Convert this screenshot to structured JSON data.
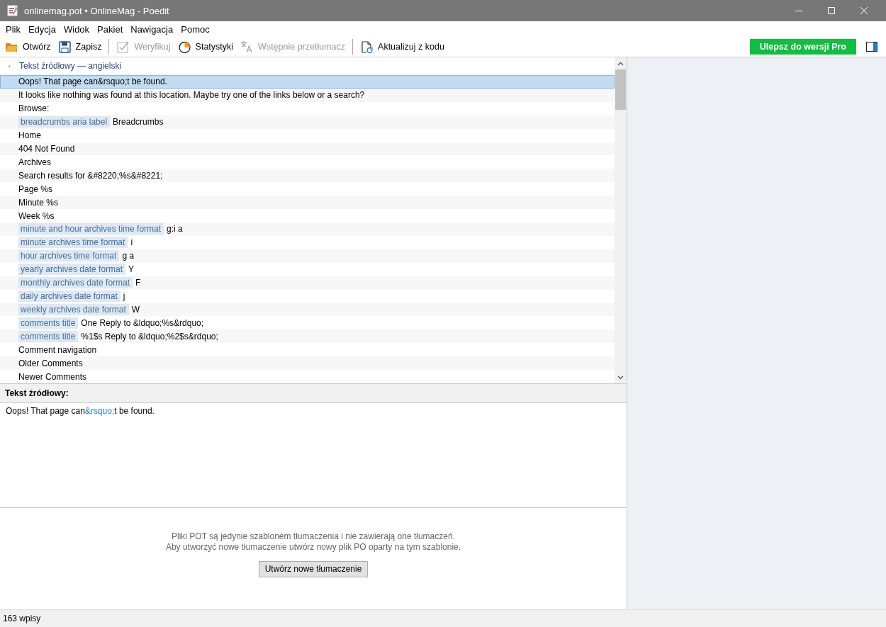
{
  "window": {
    "title": "onlinemag.pot • OnlineMag - Poedit"
  },
  "menu": [
    "Plik",
    "Edycja",
    "Widok",
    "Pakiet",
    "Nawigacja",
    "Pomoc"
  ],
  "toolbar": {
    "groups": [
      [
        {
          "kind": "open",
          "label": "Otwórz",
          "disabled": false
        },
        {
          "kind": "save",
          "label": "Zapisz",
          "disabled": false
        }
      ],
      [
        {
          "kind": "verify",
          "label": "Weryfikuj",
          "disabled": true
        },
        {
          "kind": "stats",
          "label": "Statystyki",
          "disabled": false
        },
        {
          "kind": "pretranslate",
          "label": "Wstępnie przetłumacz",
          "disabled": true
        }
      ],
      [
        {
          "kind": "update",
          "label": "Aktualizuj z kodu",
          "disabled": false
        }
      ]
    ],
    "pro_button": "Ulepsz do wersji Pro"
  },
  "list": {
    "column": "Tekst źródłowy — angielski",
    "rows": [
      {
        "text": "Oops! That page can&rsquo;t be found.",
        "selected": true
      },
      {
        "text": "It looks like nothing was found at this location. Maybe try one of the links below or a search?",
        "selected": false
      },
      {
        "text": "Browse:",
        "selected": false
      },
      {
        "context": "breadcrumbs aria label",
        "text": "Breadcrumbs",
        "selected": false
      },
      {
        "text": "Home",
        "selected": false
      },
      {
        "text": "404 Not Found",
        "selected": false
      },
      {
        "text": "Archives",
        "selected": false
      },
      {
        "text": "Search results for &#8220;%s&#8221;",
        "selected": false
      },
      {
        "text": "Page %s",
        "selected": false
      },
      {
        "text": "Minute %s",
        "selected": false
      },
      {
        "text": "Week %s",
        "selected": false
      },
      {
        "context": "minute and hour archives time format",
        "text": "g:i a",
        "selected": false
      },
      {
        "context": "minute archives time format",
        "text": "i",
        "selected": false
      },
      {
        "context": "hour archives time format",
        "text": "g a",
        "selected": false
      },
      {
        "context": "yearly archives date format",
        "text": "Y",
        "selected": false
      },
      {
        "context": "monthly archives date format",
        "text": "F",
        "selected": false
      },
      {
        "context": "daily archives date format",
        "text": "j",
        "selected": false
      },
      {
        "context": "weekly archives date format",
        "text": "W",
        "selected": false
      },
      {
        "context": "comments title",
        "text": "One Reply to &ldquo;%s&rdquo;",
        "selected": false
      },
      {
        "context": "comments title",
        "text": "%1$s Reply to &ldquo;%2$s&rdquo;",
        "selected": false
      },
      {
        "text": "Comment navigation",
        "selected": false
      },
      {
        "text": "Older Comments",
        "selected": false
      },
      {
        "text": "Newer Comments",
        "selected": false
      }
    ]
  },
  "source": {
    "label": "Tekst źródłowy:",
    "segments": [
      {
        "kind": "plain",
        "text": "Oops! That page can"
      },
      {
        "kind": "entity",
        "text": "&rsquo;"
      },
      {
        "kind": "plain",
        "text": "t be found."
      }
    ]
  },
  "notice": {
    "lines": [
      "Pliki POT są jedynie szablonem tłumaczenia i nie zawierają one tłumaczeń.",
      "Aby utworzyć nowe tłumaczenie utwórz nowy plik PO oparty na tym szablonie."
    ],
    "button": "Utwórz nowe tłumaczenie"
  },
  "status_bar": "163 wpisy"
}
